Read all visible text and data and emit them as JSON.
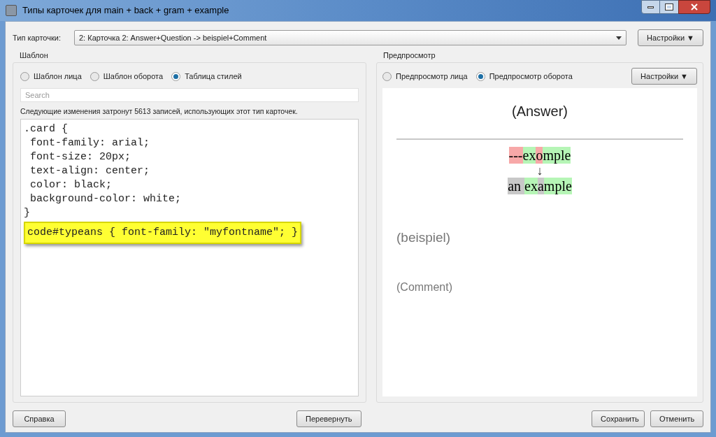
{
  "window": {
    "title": "Типы карточек для main + back + gram + example"
  },
  "card_type": {
    "label": "Тип карточки:",
    "value": "2: Карточка 2: Answer+Question -> beispiel+Comment",
    "options_button": "Настройки ▼"
  },
  "template": {
    "title": "Шаблон",
    "radios": [
      {
        "label": "Шаблон лица",
        "selected": false
      },
      {
        "label": "Шаблон оборота",
        "selected": false
      },
      {
        "label": "Таблица стилей",
        "selected": true
      }
    ],
    "search": {
      "placeholder": "Search"
    },
    "notice": "Следующие изменения затронут 5613 записей, использующих этот тип карточек.",
    "code_lines": [
      {
        "text": ".card {",
        "highlighted": false
      },
      {
        "text": " font-family: arial;",
        "highlighted": false
      },
      {
        "text": " font-size: 20px;",
        "highlighted": false
      },
      {
        "text": " text-align: center;",
        "highlighted": false
      },
      {
        "text": " color: black;",
        "highlighted": false
      },
      {
        "text": " background-color: white;",
        "highlighted": false
      },
      {
        "text": "}",
        "highlighted": false
      },
      {
        "text": "code#typeans { font-family: \"myfontname\"; }",
        "highlighted": true
      }
    ]
  },
  "preview": {
    "title": "Предпросмотр",
    "radios": [
      {
        "label": "Предпросмотр лица",
        "selected": false
      },
      {
        "label": "Предпросмотр оборота",
        "selected": true
      }
    ],
    "options_button": "Настройки ▼",
    "answer": "(Answer)",
    "typed": [
      {
        "text": "---",
        "kind": "bad"
      },
      {
        "text": "ex",
        "kind": "good"
      },
      {
        "text": "o",
        "kind": "bad"
      },
      {
        "text": "mple",
        "kind": "good"
      }
    ],
    "arrow": "↓",
    "expected": [
      {
        "text": "an ",
        "kind": "missed"
      },
      {
        "text": "ex",
        "kind": "good"
      },
      {
        "text": "a",
        "kind": "missed"
      },
      {
        "text": "mple",
        "kind": "good"
      }
    ],
    "beispiel": "(beispiel)",
    "comment": "(Comment)"
  },
  "buttons": {
    "help": "Справка",
    "flip": "Перевернуть",
    "save": "Сохранить",
    "cancel": "Отменить"
  }
}
